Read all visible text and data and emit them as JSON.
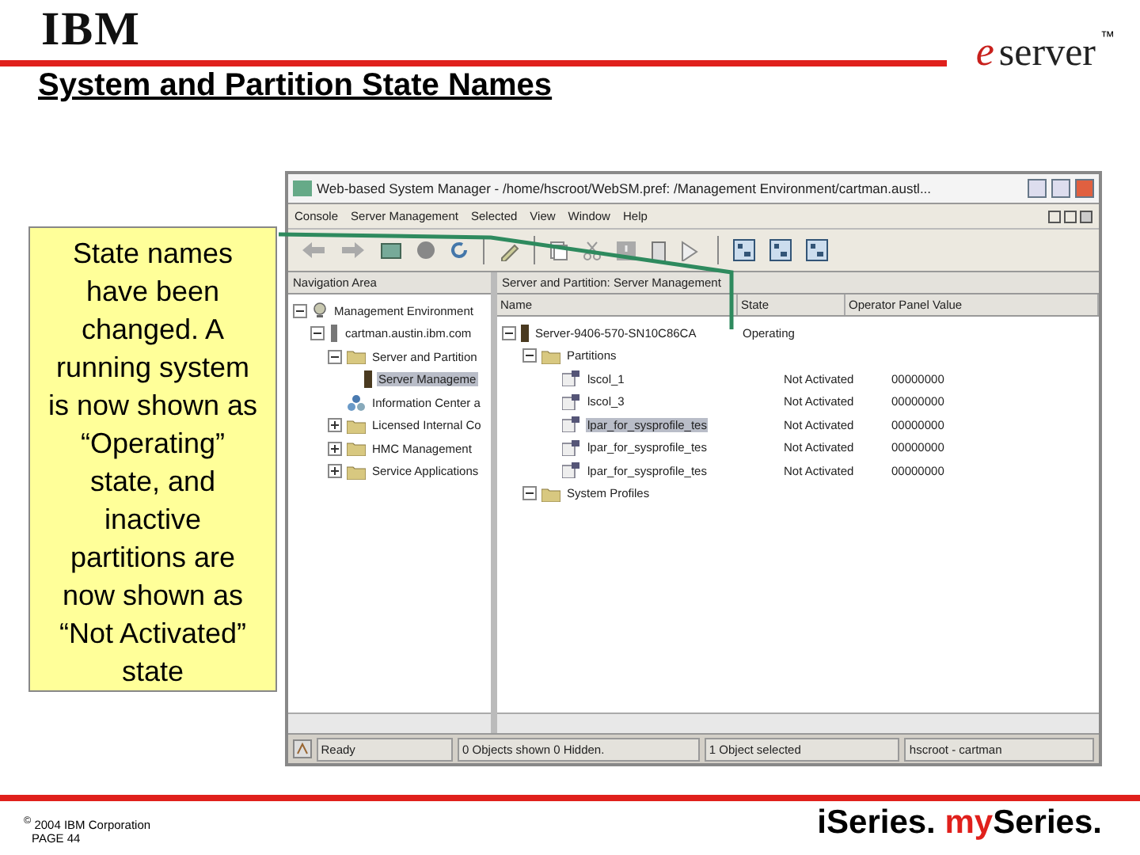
{
  "header": {
    "logo": "IBM",
    "title": "System and Partition State Names",
    "brand_e": "e",
    "brand_word": "server",
    "brand_tm": "™"
  },
  "callout": {
    "text": "State names have been changed.  A running system is now shown as “Operating” state, and inactive partitions are now shown as “Not Activated” state"
  },
  "window": {
    "title": "Web-based System Manager - /home/hscroot/WebSM.pref: /Management Environment/cartman.austl...",
    "menu": [
      "Console",
      "Server Management",
      "Selected",
      "View",
      "Window",
      "Help"
    ],
    "nav_header": "Navigation Area",
    "content_header": "Server and Partition: Server Management",
    "tree": [
      {
        "label": "Management Environment",
        "kind": "globe",
        "expanded": true,
        "selected": false,
        "children": [
          {
            "label": "cartman.austin.ibm.com",
            "kind": "host",
            "expanded": true,
            "selected": false,
            "children": [
              {
                "label": "Server and Partition",
                "kind": "folder",
                "expanded": true,
                "selected": false,
                "children": [
                  {
                    "label": "Server Manageme",
                    "kind": "server",
                    "selected": true
                  }
                ]
              },
              {
                "label": "Information Center a",
                "kind": "info",
                "selected": false
              },
              {
                "label": "Licensed Internal Co",
                "kind": "folder",
                "expanded": false,
                "selected": false
              },
              {
                "label": "HMC Management",
                "kind": "folder",
                "expanded": false,
                "selected": false
              },
              {
                "label": "Service Applications",
                "kind": "folder",
                "expanded": false,
                "selected": false
              }
            ]
          }
        ]
      }
    ],
    "columns": [
      "Name",
      "State",
      "Operator Panel Value"
    ],
    "rows": [
      {
        "name": "Server-9406-570-SN10C86CA",
        "kind": "server",
        "state": "Operating",
        "expanded": true,
        "selected": false,
        "children": [
          {
            "name": "Partitions",
            "kind": "folder",
            "expanded": true,
            "selected": false,
            "children": [
              {
                "name": "lscol_1",
                "kind": "partition",
                "state": "Not Activated",
                "panel_value": "00000000",
                "selected": false
              },
              {
                "name": "lscol_3",
                "kind": "partition",
                "state": "Not Activated",
                "panel_value": "00000000",
                "selected": false
              },
              {
                "name": "lpar_for_sysprofile_tes",
                "kind": "partition",
                "state": "Not Activated",
                "panel_value": "00000000",
                "selected": true
              },
              {
                "name": "lpar_for_sysprofile_tes",
                "kind": "partition",
                "state": "Not Activated",
                "panel_value": "00000000",
                "selected": false
              },
              {
                "name": "lpar_for_sysprofile_tes",
                "kind": "partition",
                "state": "Not Activated",
                "panel_value": "00000000",
                "selected": false
              }
            ]
          },
          {
            "name": "System Profiles",
            "kind": "folder",
            "expanded": true,
            "selected": false
          }
        ]
      }
    ],
    "status": [
      "Ready",
      "0 Objects shown 0 Hidden.",
      "1 Object selected",
      "hscroot - cartman"
    ]
  },
  "footer": {
    "copyright": "$^{©}$ 2004 IBM Corporation",
    "page": "PAGE 44",
    "slogan_a": "iSeries.",
    "slogan_b": "my",
    "slogan_c": "Series."
  }
}
